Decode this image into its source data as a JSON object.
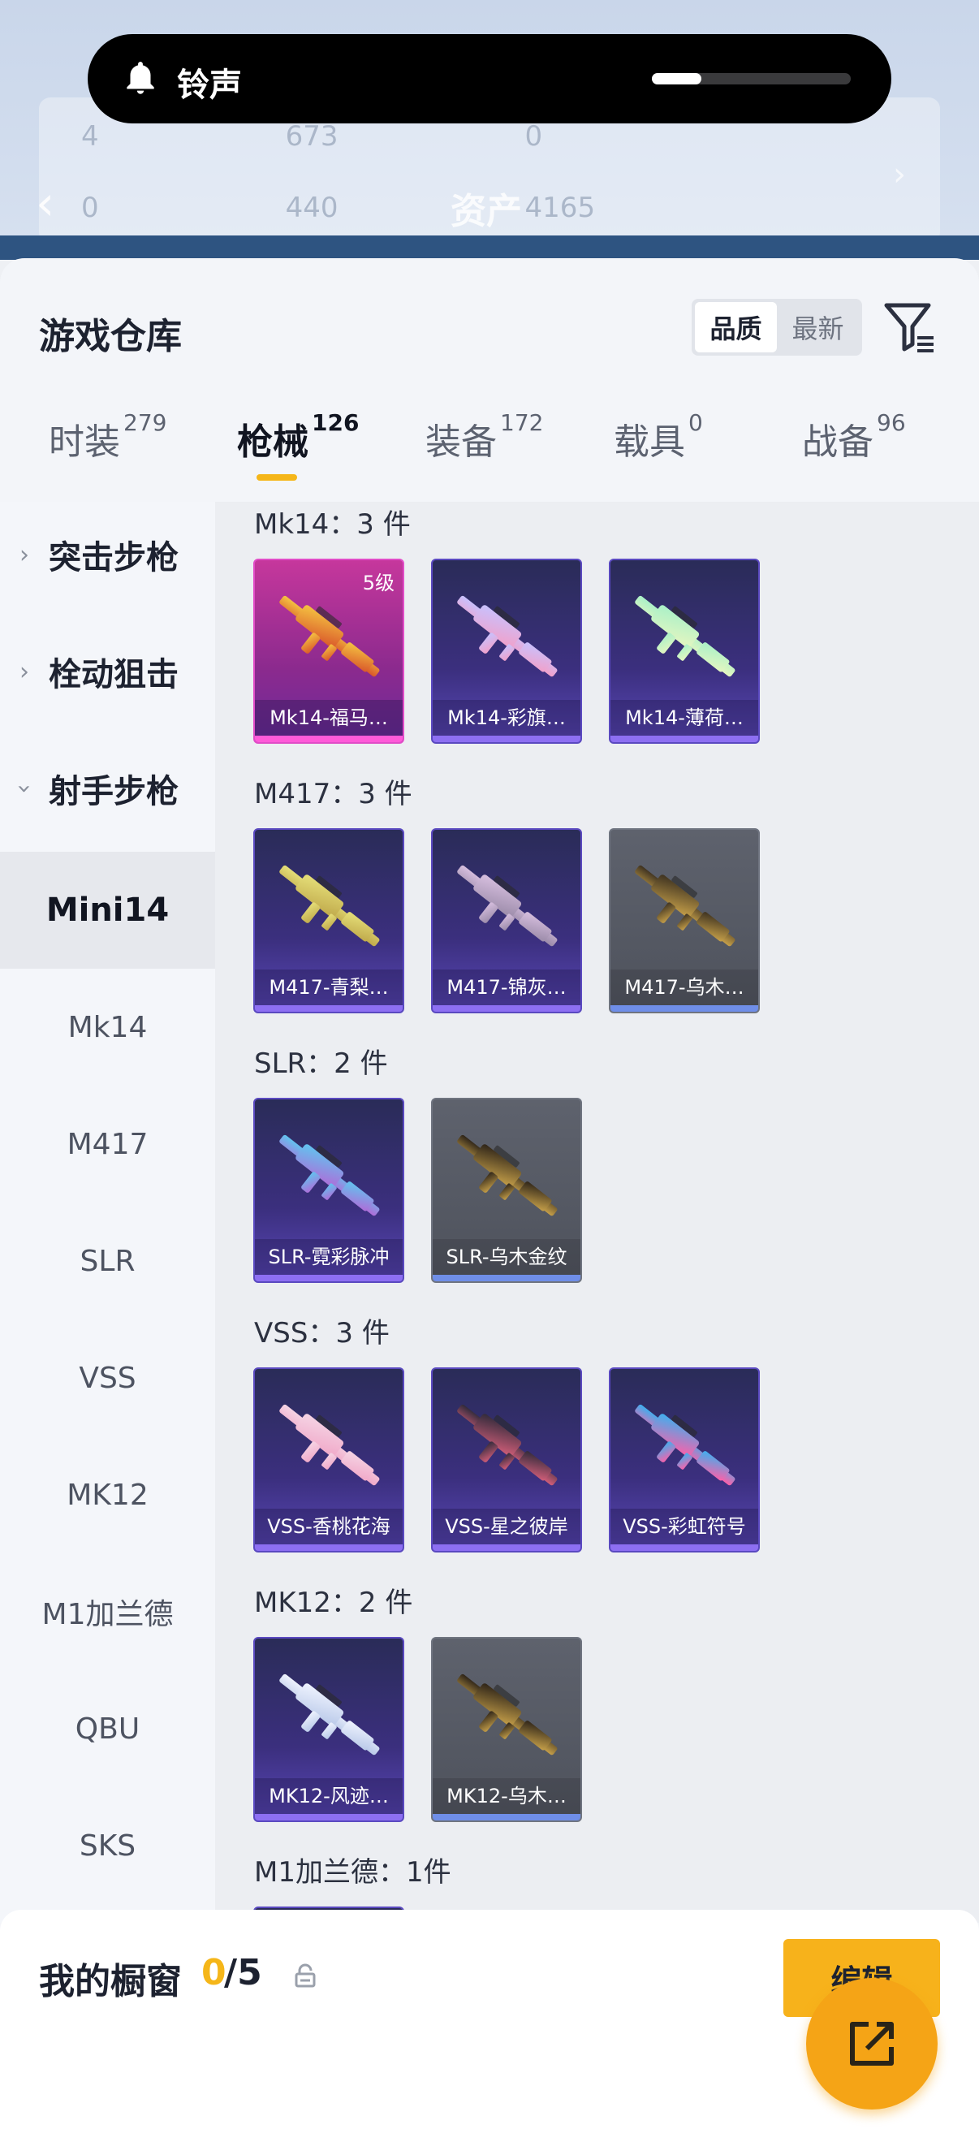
{
  "ringer": {
    "label": "铃声",
    "level": 0.25
  },
  "background_header": {
    "title": "资产",
    "stats_row1": [
      "4",
      "673",
      "0"
    ],
    "stats_row2": [
      "0",
      "440",
      "4165"
    ]
  },
  "sheet": {
    "title": "游戏仓库",
    "sort_options": [
      "品质",
      "最新"
    ],
    "sort_selected": "品质"
  },
  "tabs": [
    {
      "label": "时装",
      "count": "279"
    },
    {
      "label": "枪械",
      "count": "126",
      "active": true
    },
    {
      "label": "装备",
      "count": "172"
    },
    {
      "label": "载具",
      "count": "0"
    },
    {
      "label": "战备",
      "count": "96"
    }
  ],
  "leftnav": {
    "categories": [
      "突击步枪",
      "栓动狙击",
      "射手步枪"
    ],
    "subitems": [
      "Mini14",
      "Mk14",
      "M417",
      "SLR",
      "VSS",
      "MK12",
      "M1加兰德",
      "QBU",
      "SKS"
    ],
    "active_subitem": "Mini14"
  },
  "groups": [
    {
      "title": "Mk14：3 件",
      "items": [
        {
          "name": "Mk14-福马…",
          "rarity": "pink",
          "level": "5级"
        },
        {
          "name": "Mk14-彩旗…",
          "rarity": "purple"
        },
        {
          "name": "Mk14-薄荷…",
          "rarity": "purple"
        }
      ]
    },
    {
      "title": "M417：3 件",
      "items": [
        {
          "name": "M417-青梨…",
          "rarity": "purple"
        },
        {
          "name": "M417-锦灰…",
          "rarity": "purple"
        },
        {
          "name": "M417-乌木…",
          "rarity": "gray"
        }
      ]
    },
    {
      "title": "SLR：2 件",
      "items": [
        {
          "name": "SLR-霓彩脉冲",
          "rarity": "purple"
        },
        {
          "name": "SLR-乌木金纹",
          "rarity": "gray"
        }
      ]
    },
    {
      "title": "VSS：3 件",
      "items": [
        {
          "name": "VSS-香桃花海",
          "rarity": "purple"
        },
        {
          "name": "VSS-星之彼岸",
          "rarity": "purple"
        },
        {
          "name": "VSS-彩虹符号",
          "rarity": "purple"
        }
      ]
    },
    {
      "title": "MK12：2 件",
      "items": [
        {
          "name": "MK12-风迹…",
          "rarity": "purple"
        },
        {
          "name": "MK12-乌木…",
          "rarity": "gray"
        }
      ]
    },
    {
      "title": "M1加兰德：1件",
      "items": [
        {
          "name": "",
          "rarity": "purple"
        }
      ]
    }
  ],
  "showcase": {
    "label": "我的橱窗",
    "used": "0",
    "separator": "/5",
    "edit_label": "编辑"
  },
  "colors": {
    "accent": "#f5b619",
    "purple_card": "#3b2f7e",
    "pink_card": "#c6379c",
    "gray_card": "#5e626d"
  },
  "icons": {
    "bell": "bell-icon",
    "filter": "filter-icon",
    "share": "share-out-icon",
    "lock": "lock-icon",
    "back": "back-chevron-icon"
  }
}
